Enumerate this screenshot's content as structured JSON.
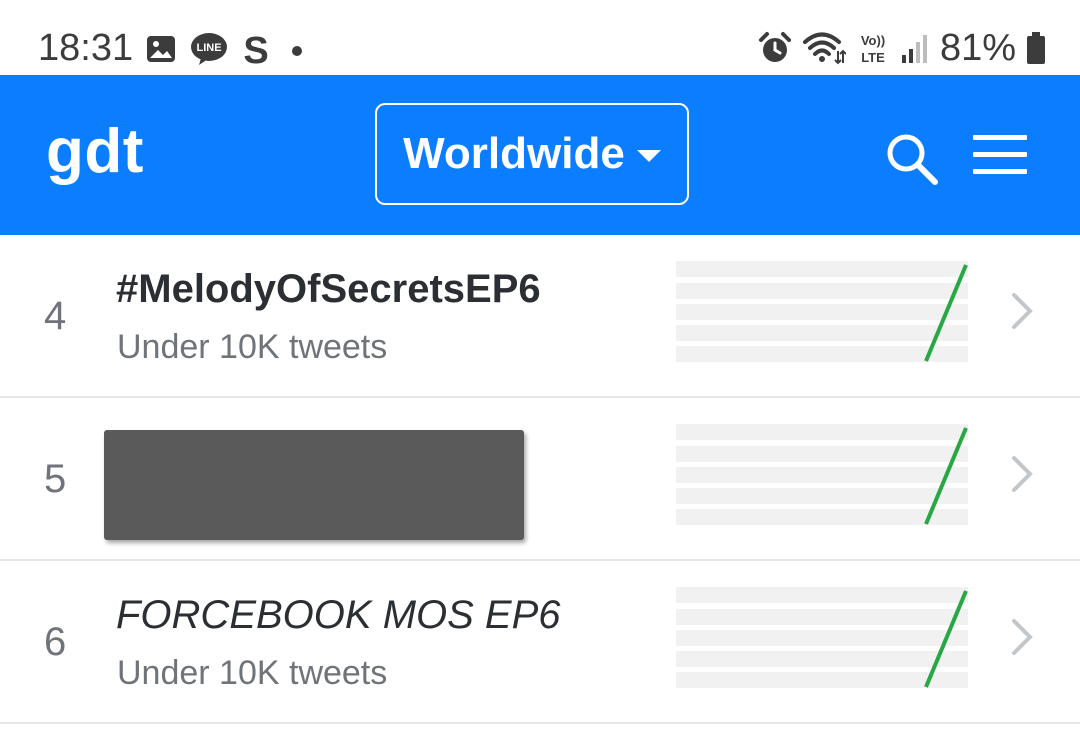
{
  "status_bar": {
    "time": "18:31",
    "left_icons": [
      "gallery-icon",
      "line-app-icon",
      "s-app-icon",
      "notification-dot-icon"
    ],
    "right_icons": [
      "alarm-icon",
      "wifi-icon",
      "volte-icon",
      "signal-icon",
      "battery-icon"
    ],
    "volte_top": "Vo))",
    "volte_bottom": "LTE",
    "line_label": "LINE",
    "s_label": "S",
    "battery": "81%"
  },
  "header": {
    "brand": "gdt",
    "region_label": "Worldwide",
    "accent_color": "#0b7dff"
  },
  "trends": [
    {
      "rank": "4",
      "title": "#MelodyOfSecretsEP6",
      "subtitle": "Under 10K tweets",
      "italic": false
    },
    {
      "rank": "5",
      "title": "",
      "subtitle": "",
      "redacted": true
    },
    {
      "rank": "6",
      "title": "FORCEBOOK MOS EP6",
      "subtitle": "Under 10K tweets",
      "italic": true
    }
  ],
  "sparkline_color": "#28a745"
}
